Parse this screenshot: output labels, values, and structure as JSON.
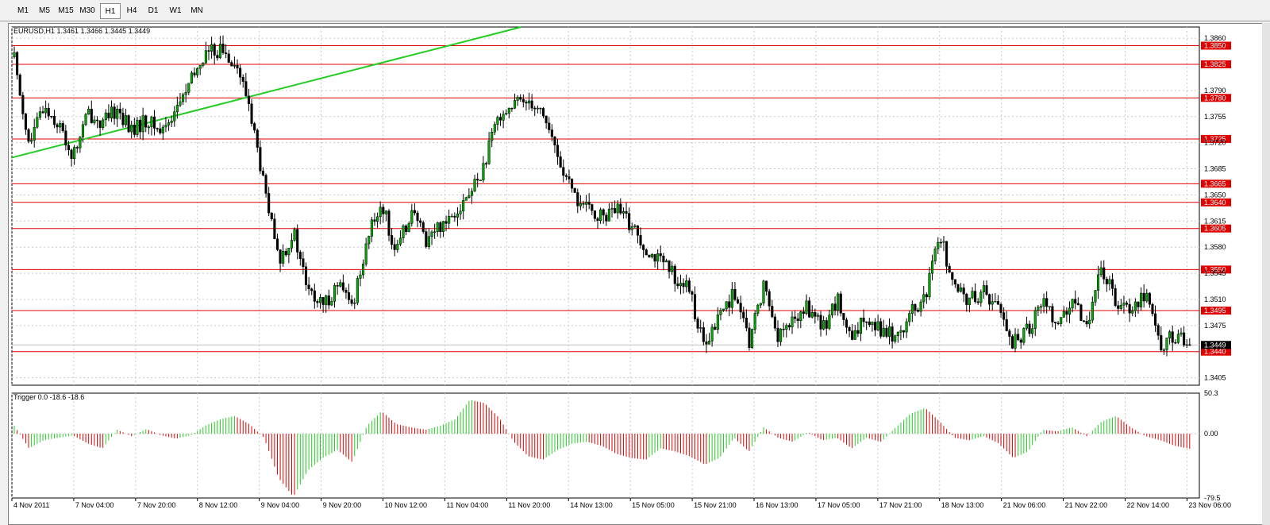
{
  "toolbar": {
    "timeframes": [
      "M1",
      "M5",
      "M15",
      "M30",
      "H1",
      "H4",
      "D1",
      "W1",
      "MN"
    ],
    "active": "H1"
  },
  "chart_data": {
    "type": "candlestick",
    "symbol_label": "EURUSD,H1  1.3461 1.3466 1.3445 1.3449",
    "current_price": "1.3449",
    "ylim": [
      1.3395,
      1.3875
    ],
    "y_ticks": [
      "1.3860",
      "1.3790",
      "1.3755",
      "1.3720",
      "1.3685",
      "1.3650",
      "1.3615",
      "1.3580",
      "1.3545",
      "1.3510",
      "1.3475",
      "1.3405"
    ],
    "horizontal_levels": [
      "1.3850",
      "1.3825",
      "1.3780",
      "1.3725",
      "1.3665",
      "1.3640",
      "1.3605",
      "1.3550",
      "1.3495",
      "1.3440"
    ],
    "x_labels": [
      "4 Nov 2011",
      "7 Nov 04:00",
      "7 Nov 20:00",
      "8 Nov 12:00",
      "9 Nov 04:00",
      "9 Nov 20:00",
      "10 Nov 12:00",
      "11 Nov 04:00",
      "11 Nov 20:00",
      "14 Nov 13:00",
      "15 Nov 05:00",
      "15 Nov 21:00",
      "16 Nov 13:00",
      "17 Nov 05:00",
      "17 Nov 21:00",
      "18 Nov 13:00",
      "21 Nov 06:00",
      "21 Nov 22:00",
      "22 Nov 14:00",
      "23 Nov 06:00"
    ],
    "trendline": {
      "start": [
        "4 Nov 2011",
        1.37
      ],
      "end": [
        "11 Nov 20:00",
        1.387
      ]
    },
    "close_path": [
      1.3835,
      1.3715,
      1.377,
      1.3745,
      1.37,
      1.376,
      1.3745,
      1.3765,
      1.3735,
      1.375,
      1.3735,
      1.3765,
      1.38,
      1.384,
      1.3845,
      1.383,
      1.377,
      1.366,
      1.356,
      1.36,
      1.352,
      1.35,
      1.353,
      1.35,
      1.359,
      1.364,
      1.357,
      1.363,
      1.359,
      1.361,
      1.363,
      1.365,
      1.369,
      1.376,
      1.377,
      1.378,
      1.376,
      1.37,
      1.365,
      1.363,
      1.362,
      1.363,
      1.361,
      1.358,
      1.356,
      1.354,
      1.352,
      1.344,
      1.349,
      1.352,
      1.345,
      1.353,
      1.346,
      1.348,
      1.35,
      1.347,
      1.351,
      1.345,
      1.349,
      1.347,
      1.346,
      1.349,
      1.351,
      1.36,
      1.352,
      1.351,
      1.352,
      1.35,
      1.345,
      1.347,
      1.351,
      1.348,
      1.35,
      1.348,
      1.355,
      1.351,
      1.35,
      1.352,
      1.345,
      1.346,
      1.3449
    ],
    "indicator": {
      "label": "Trigger 0.0 -18.6 -18.6",
      "ylim": [
        -79.5,
        50.3
      ],
      "y_ticks": [
        "50.3",
        "0.00",
        "-79.5"
      ],
      "values": [
        10,
        -18,
        -8,
        -5,
        -2,
        -12,
        -18,
        5,
        -3,
        6,
        -2,
        -6,
        -2,
        10,
        18,
        22,
        12,
        -5,
        -55,
        -78,
        -45,
        -30,
        -20,
        -35,
        10,
        28,
        12,
        8,
        5,
        10,
        18,
        42,
        38,
        20,
        -10,
        -28,
        -32,
        -20,
        -12,
        -10,
        -15,
        -25,
        -30,
        -32,
        -18,
        -22,
        -28,
        -38,
        -30,
        -5,
        -22,
        8,
        -5,
        -10,
        2,
        -8,
        -5,
        -18,
        -5,
        -10,
        8,
        25,
        32,
        15,
        -5,
        -8,
        -3,
        -12,
        -30,
        -22,
        5,
        3,
        8,
        -3,
        15,
        22,
        8,
        -3,
        -8,
        -15,
        -18.6
      ]
    }
  }
}
